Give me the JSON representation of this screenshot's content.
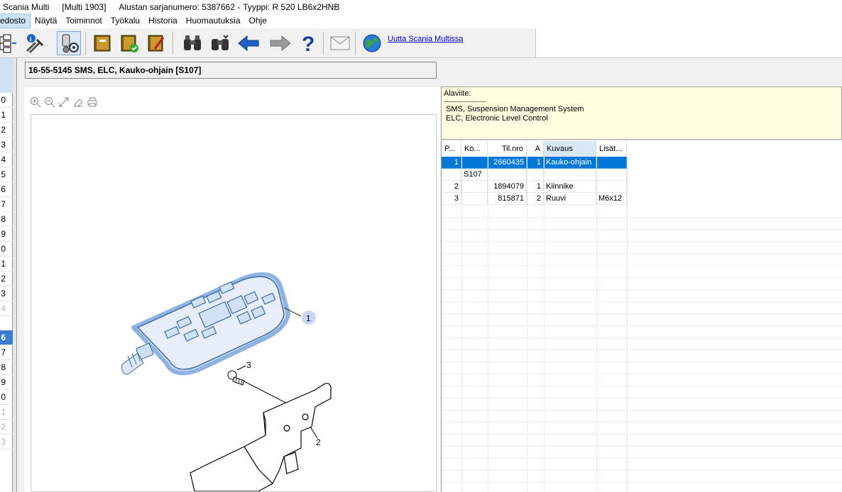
{
  "titlebar": {
    "app": "Scania Multi",
    "version": "[Multi 1903]",
    "chassis": "Alustan sarjanumero: 5387662 -",
    "type": "Tyyppi: R 520 LB6x2HNB"
  },
  "menu": [
    "edosto",
    "Näytä",
    "Toiminnot",
    "Työkalu",
    "Historia",
    "Huomautuksia",
    "Ohje"
  ],
  "toolbar": {
    "link": "Uutta Scania Multissa"
  },
  "leftstrip": {
    "rows": [
      "",
      "0",
      "1",
      "2",
      "3",
      "4",
      "5",
      "6",
      "7",
      "8",
      "9",
      "0",
      "1",
      "2",
      "3",
      "4",
      "6",
      "7",
      "8",
      "9",
      "0",
      "1",
      "2",
      "3"
    ]
  },
  "heading": "16-55-5145 SMS, ELC, Kauko-ohjain [S107]",
  "drawing": {
    "callouts": [
      "1",
      "2",
      "3"
    ]
  },
  "footnote": {
    "title": "Alaviite:",
    "rule": "--------------------",
    "lines": [
      "SMS, Suspension Management System",
      "ELC, Electronic Level Control"
    ]
  },
  "table": {
    "columns": [
      "P...",
      "Ko...",
      "Til.nro",
      "A",
      "Kuvaus",
      "Lisät..."
    ],
    "rows": [
      {
        "pos": "1",
        "code": "",
        "part": "2660435",
        "qty": "1",
        "desc": "Kauko-ohjain",
        "extra": ""
      },
      {
        "pos": "",
        "code": "S107",
        "part": "",
        "qty": "",
        "desc": "",
        "extra": ""
      },
      {
        "pos": "2",
        "code": "",
        "part": "1894079",
        "qty": "1",
        "desc": "Kiinnike",
        "extra": ""
      },
      {
        "pos": "3",
        "code": "",
        "part": "815871",
        "qty": "2",
        "desc": "Ruuvi",
        "extra": "M6x12"
      }
    ]
  },
  "colors": {
    "selection": "#0078d7",
    "footnote_bg": "#ffffe1",
    "highlight_part": "#9cbde6"
  }
}
